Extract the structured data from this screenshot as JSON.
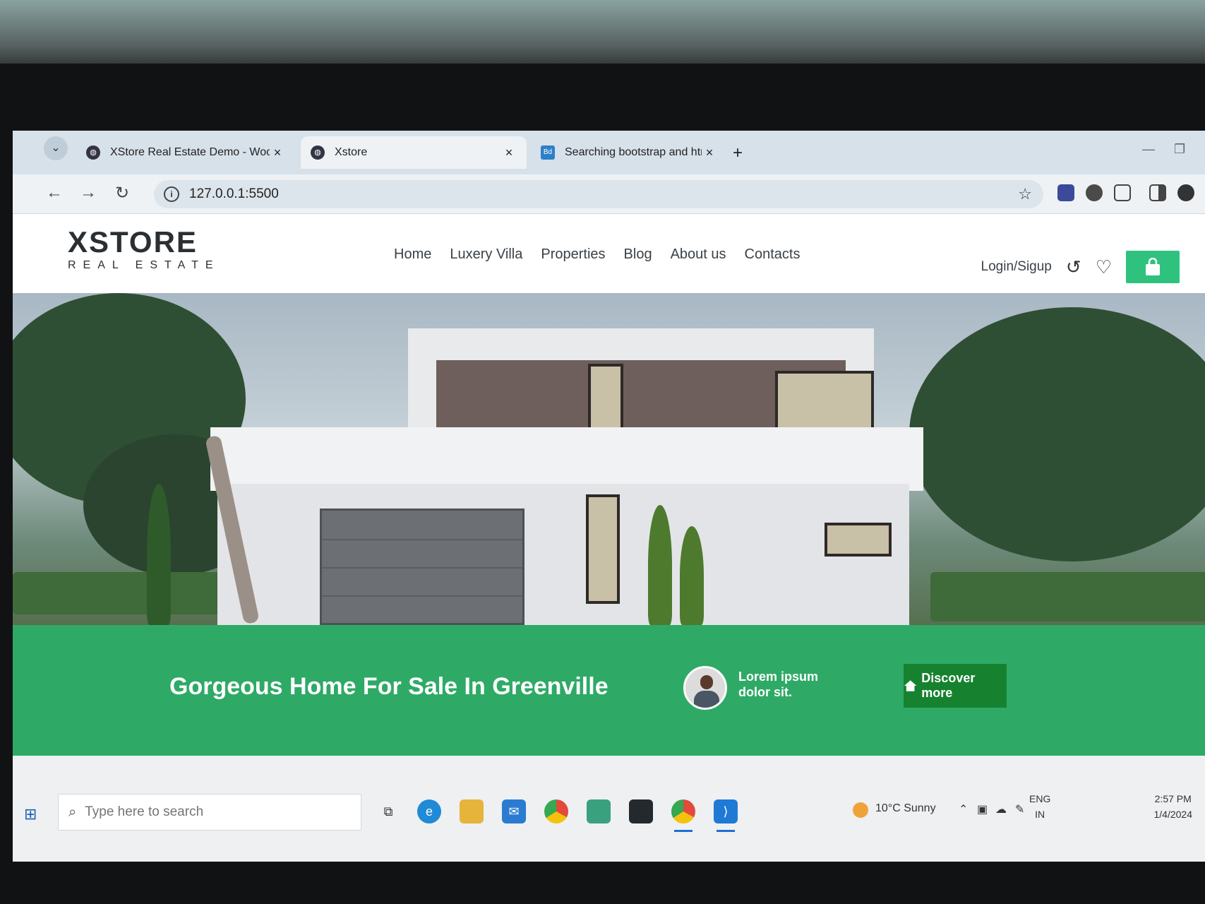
{
  "browser": {
    "tabs": [
      {
        "title": "XStore Real Estate Demo - Woo",
        "favicon": "globe-icon",
        "active": false
      },
      {
        "title": "Xstore",
        "favicon": "globe-icon",
        "active": true
      },
      {
        "title": "Searching bootstrap and html e",
        "favicon": "Bd",
        "active": false
      }
    ],
    "new_tab": "+",
    "close_glyph": "×",
    "url": "127.0.0.1:5500"
  },
  "site": {
    "logo": {
      "main": "XSTORE",
      "sub": "REAL ESTATE"
    },
    "menu": [
      "Home",
      "Luxery Villa",
      "Properties",
      "Blog",
      "About us",
      "Contacts"
    ],
    "login_label": "Login/Sigup",
    "accent_color": "#2ec27e"
  },
  "banner": {
    "title": "Gorgeous Home For Sale In Greenville",
    "agent_text": "Lorem ipsum dolor sit.",
    "cta_label": "Discover more",
    "background": "#2eaa66"
  },
  "taskbar": {
    "search_placeholder": "Type here to search",
    "weather": "10°C  Sunny",
    "lang_top": "ENG",
    "lang_bottom": "IN",
    "time": "2:57 PM",
    "date": "1/4/2024"
  }
}
